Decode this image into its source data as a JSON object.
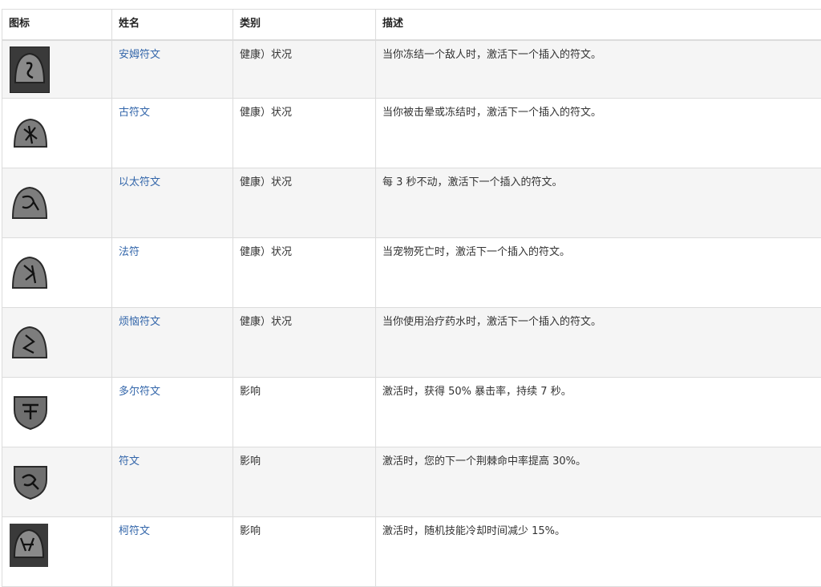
{
  "table": {
    "headers": [
      "图标",
      "姓名",
      "类别",
      "描述"
    ],
    "rows": [
      {
        "icon": "rune-square-icon",
        "name": "安姆符文",
        "category": "健康）状况",
        "description": "当你冻结一个敌人时，激活下一个插入的符文。"
      },
      {
        "icon": "rune-arch-icon",
        "name": "古符文",
        "category": "健康）状况",
        "description": "当你被击晕或冻结时，激活下一个插入的符文。"
      },
      {
        "icon": "rune-arch-icon",
        "name": "以太符文",
        "category": "健康）状况",
        "description": "每 3 秒不动，激活下一个插入的符文。"
      },
      {
        "icon": "rune-arch-icon",
        "name": "法符",
        "category": "健康）状况",
        "description": "当宠物死亡时，激活下一个插入的符文。"
      },
      {
        "icon": "rune-arch-icon",
        "name": "烦恼符文",
        "category": "健康）状况",
        "description": "当你使用治疗药水时，激活下一个插入的符文。"
      },
      {
        "icon": "rune-shield-icon",
        "name": "多尔符文",
        "category": "影响",
        "description": "激活时，获得 50% 暴击率，持续 7 秒。"
      },
      {
        "icon": "rune-shield-icon",
        "name": "符文",
        "category": "影响",
        "description": "激活时，您的下一个荆棘命中率提高 30%。"
      },
      {
        "icon": "rune-square-icon",
        "name": "柯符文",
        "category": "影响",
        "description": "激活时，随机技能冷却时间减少 15%。"
      }
    ]
  }
}
